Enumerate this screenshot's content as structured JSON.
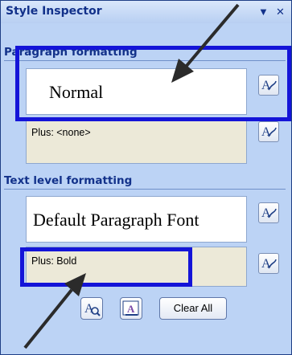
{
  "pane": {
    "title": "Style Inspector",
    "menu_glyph": "▼",
    "close_glyph": "✕"
  },
  "paragraph": {
    "header": "Paragraph formatting",
    "style_name": "Normal",
    "plus_text": "Plus: <none>"
  },
  "text_level": {
    "header": "Text level formatting",
    "style_name": "Default Paragraph Font",
    "plus_text": "Plus: Bold"
  },
  "footer": {
    "clear_all_label": "Clear All"
  },
  "colors": {
    "highlight": "#1414d8",
    "title": "#12318a",
    "pane_bg": "#bcd3f5",
    "beige_box": "#ece9d8"
  },
  "icons": [
    "style-picker-icon",
    "reveal-formatting-icon",
    "new-style-icon",
    "arrow-annotation-icon"
  ]
}
